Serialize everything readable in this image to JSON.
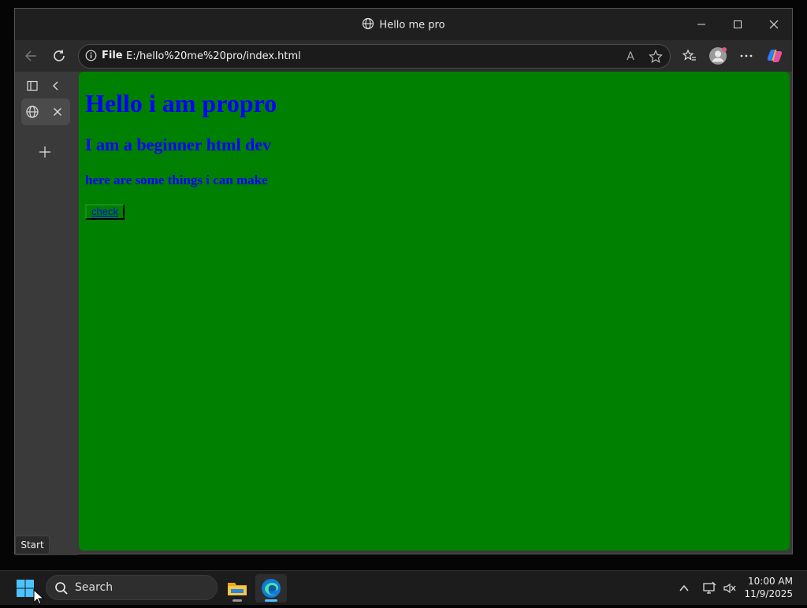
{
  "window": {
    "title": "Hello me pro"
  },
  "toolbar": {
    "site_info_label": "File",
    "url": "E:/hello%20me%20pro/index.html",
    "read_aloud_label": "A"
  },
  "page": {
    "heading1": "Hello i am propro",
    "heading2": "I am a beginner html dev",
    "heading3": "here are some things i can make",
    "button_label": "check",
    "background_color": "#008000",
    "text_color": "#0000ff"
  },
  "taskbar": {
    "start_tooltip": "Start",
    "search_placeholder": "Search",
    "time": "10:00 AM",
    "date": "11/9/2025"
  }
}
